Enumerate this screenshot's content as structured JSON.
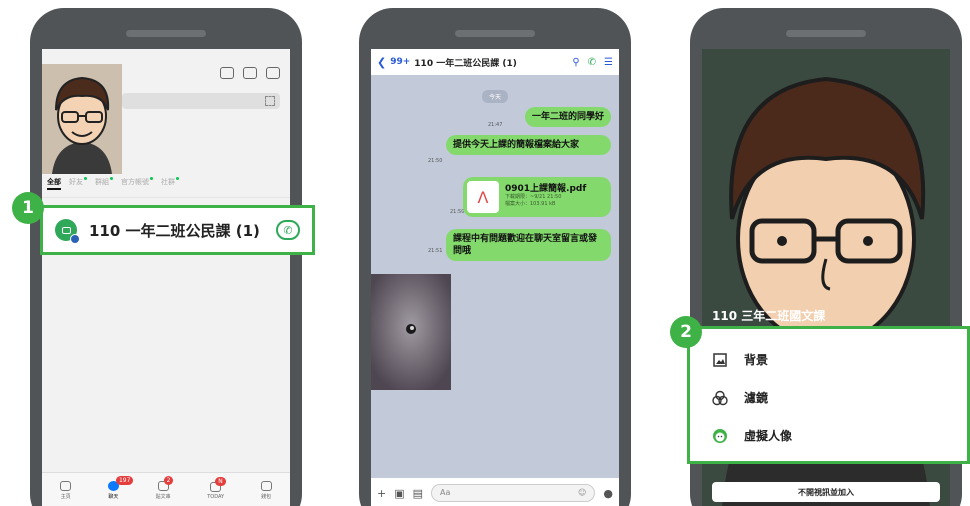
{
  "phone1": {
    "tabs": [
      {
        "label": "全部",
        "active": true
      },
      {
        "label": "好友",
        "active": false
      },
      {
        "label": "群組",
        "active": false
      },
      {
        "label": "官方帳號",
        "active": false
      },
      {
        "label": "社群",
        "active": false
      }
    ],
    "highlighted_chat": {
      "name": "110 一年二班公民課 (1)"
    },
    "bottom_nav": [
      {
        "label": "主頁",
        "badge": ""
      },
      {
        "label": "聊天",
        "badge": "197"
      },
      {
        "label": "貼文串",
        "badge": "2"
      },
      {
        "label": "TODAY",
        "badge": "N"
      },
      {
        "label": "錢包",
        "badge": ""
      }
    ]
  },
  "step1": "1",
  "phone2": {
    "header": {
      "back_count": "99+",
      "title": "110 一年二班公民課 (1)"
    },
    "date_pill": "今天",
    "messages": [
      {
        "time": "21:47",
        "text": "一年二班的同學好"
      },
      {
        "time": "21:50",
        "text": "提供今天上課的簡報檔案給大家"
      },
      {
        "time": "21:51",
        "text": "課程中有問題歡迎在聊天室留言或發問哦"
      }
    ],
    "file": {
      "time": "21:50",
      "name": "0901上課簡報.pdf",
      "expiry": "下載期限：~9/21 21:50",
      "size": "檔案大小：103.91 kB"
    },
    "input_placeholder": "Aa"
  },
  "phone3": {
    "caption": "110 三年二班國文課",
    "join_button": "不開視訊並加入",
    "menu": [
      {
        "icon": "image-icon",
        "label": "背景"
      },
      {
        "icon": "filter-icon",
        "label": "濾鏡"
      },
      {
        "icon": "avatar-icon",
        "label": "虛擬人像"
      }
    ]
  },
  "step2": "2",
  "colors": {
    "accent_green": "#3fb247",
    "bubble_green": "#84d96d",
    "chat_bg": "#c2cad9",
    "link_blue": "#2a5bd7"
  }
}
